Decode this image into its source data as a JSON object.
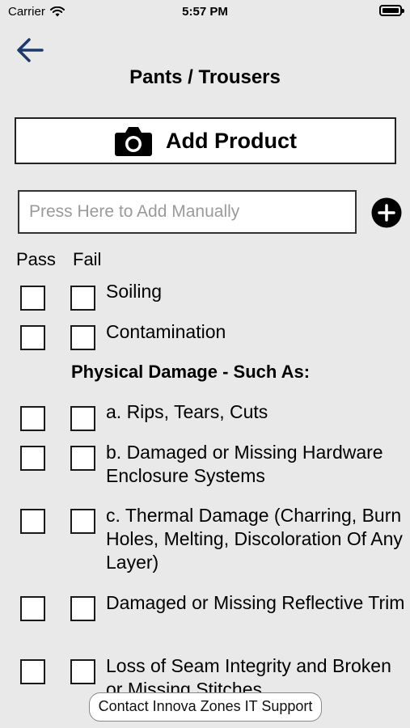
{
  "status_bar": {
    "carrier": "Carrier",
    "time": "5:57 PM"
  },
  "header": {
    "title": "Pants / Trousers"
  },
  "add_product": {
    "label": "Add Product"
  },
  "manual": {
    "placeholder": "Press Here to Add Manually"
  },
  "columns": {
    "pass": "Pass",
    "fail": "Fail"
  },
  "items": [
    {
      "label": "Soiling"
    },
    {
      "label": "Contamination"
    },
    {
      "label": "a. Rips, Tears, Cuts"
    },
    {
      "label": "b. Damaged or Missing Hardware Enclosure Systems"
    },
    {
      "label": "c. Thermal Damage (Charring, Burn Holes, Melting, Discoloration Of Any Layer)"
    },
    {
      "label": "Damaged or Missing Reflective Trim"
    },
    {
      "label": "Loss of Seam Integrity and Broken or Missing Stitches"
    }
  ],
  "section": {
    "physical_damage": "Physical Damage - Such As:"
  },
  "support": {
    "label": "Contact Innova Zones IT Support"
  },
  "colors": {
    "back_arrow": "#1b3a6b",
    "background": "#e9e9e9"
  }
}
